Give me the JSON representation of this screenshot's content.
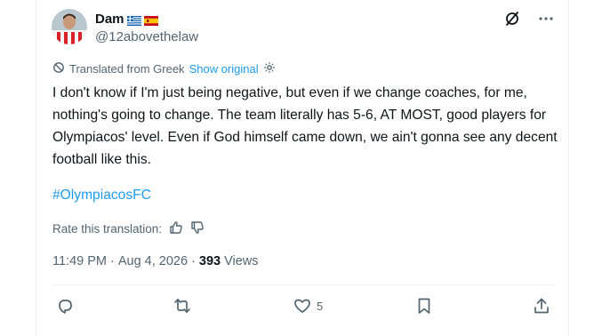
{
  "author": {
    "display_name": "Dam",
    "flags": [
      "greece-flag-icon",
      "spain-flag-icon"
    ],
    "handle": "@12abovethelaw"
  },
  "translation": {
    "label": "Translated from Greek",
    "show_original": "Show original"
  },
  "tweet": {
    "text": "I don't know if I'm just being negative, but even if we change coaches, for me, nothing's going to change. The team literally has 5-6, AT MOST, good players for Olympiacos' level. Even if God himself came down, we ain't gonna see any decent football like this.",
    "hashtag": "#OlympiacosFC"
  },
  "rate": {
    "label": "Rate this translation:"
  },
  "meta": {
    "time": "11:49 PM",
    "separator1": "·",
    "date": "Aug 4, 2026",
    "separator2": "·",
    "views_count": "393",
    "views_label": "Views"
  },
  "actions": {
    "reply_count": "",
    "repost_count": "",
    "like_count": "5",
    "bookmark_count": ""
  },
  "colors": {
    "accent": "#1d9bf0",
    "secondary_text": "#536471",
    "primary_text": "#0f1419"
  },
  "icons": [
    "grok-icon",
    "more-icon",
    "translate-icon",
    "gear-icon",
    "thumbs-up-icon",
    "thumbs-down-icon",
    "reply-icon",
    "repost-icon",
    "like-icon",
    "bookmark-icon",
    "share-icon"
  ]
}
